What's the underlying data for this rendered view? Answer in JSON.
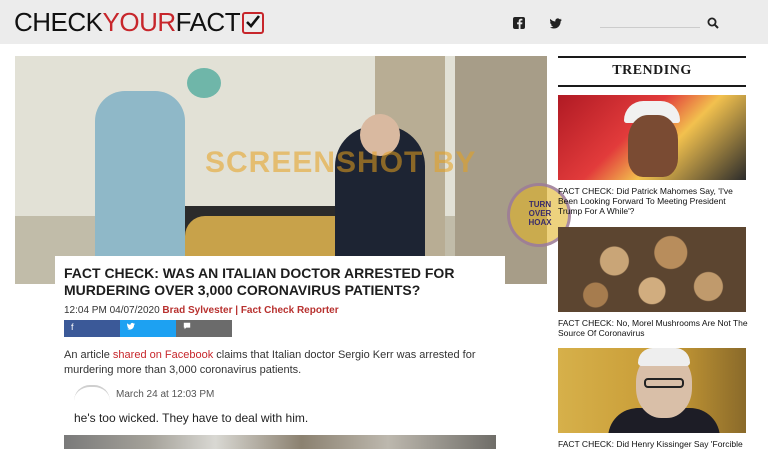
{
  "header": {
    "logo": {
      "part1": "CHECK",
      "part2": "YOUR",
      "part3": "FACT"
    },
    "social_icons": [
      "facebook-icon",
      "twitter-icon"
    ],
    "search_icon": "search-icon",
    "colors": {
      "brand_red": "#c7262b",
      "header_bg": "#ececec"
    }
  },
  "hero": {
    "watermark": "SCREENSHOT BY",
    "stamp_text": "TURN\nOVER\nHOAX"
  },
  "article": {
    "headline": "FACT CHECK: WAS AN ITALIAN DOCTOR ARRESTED FOR MURDERING OVER 3,000 CORONAVIRUS PATIENTS?",
    "timestamp": "12:04 PM 04/07/2020",
    "author": "Brad Sylvester | Fact Check Reporter",
    "share": {
      "facebook": "f",
      "twitter": "t",
      "comment": "c"
    },
    "body": {
      "lead": "An article ",
      "link": "shared on Facebook",
      "rest": " claims that Italian doctor Sergio Kerr was arrested for murdering more than 3,000 coronavirus patients."
    },
    "embed": {
      "date": "March 24 at 12:03 PM",
      "text": "he's too wicked. They have to deal with him."
    }
  },
  "sidebar": {
    "title": "TRENDING",
    "items": [
      {
        "caption": "FACT CHECK: Did Patrick Mahomes Say, 'I've Been Looking Forward To Meeting President Trump For A While'?"
      },
      {
        "caption": "FACT CHECK: No, Morel Mushrooms Are Not The Source Of Coronavirus"
      },
      {
        "caption": "FACT CHECK: Did Henry Kissinger Say 'Forcible"
      }
    ]
  }
}
